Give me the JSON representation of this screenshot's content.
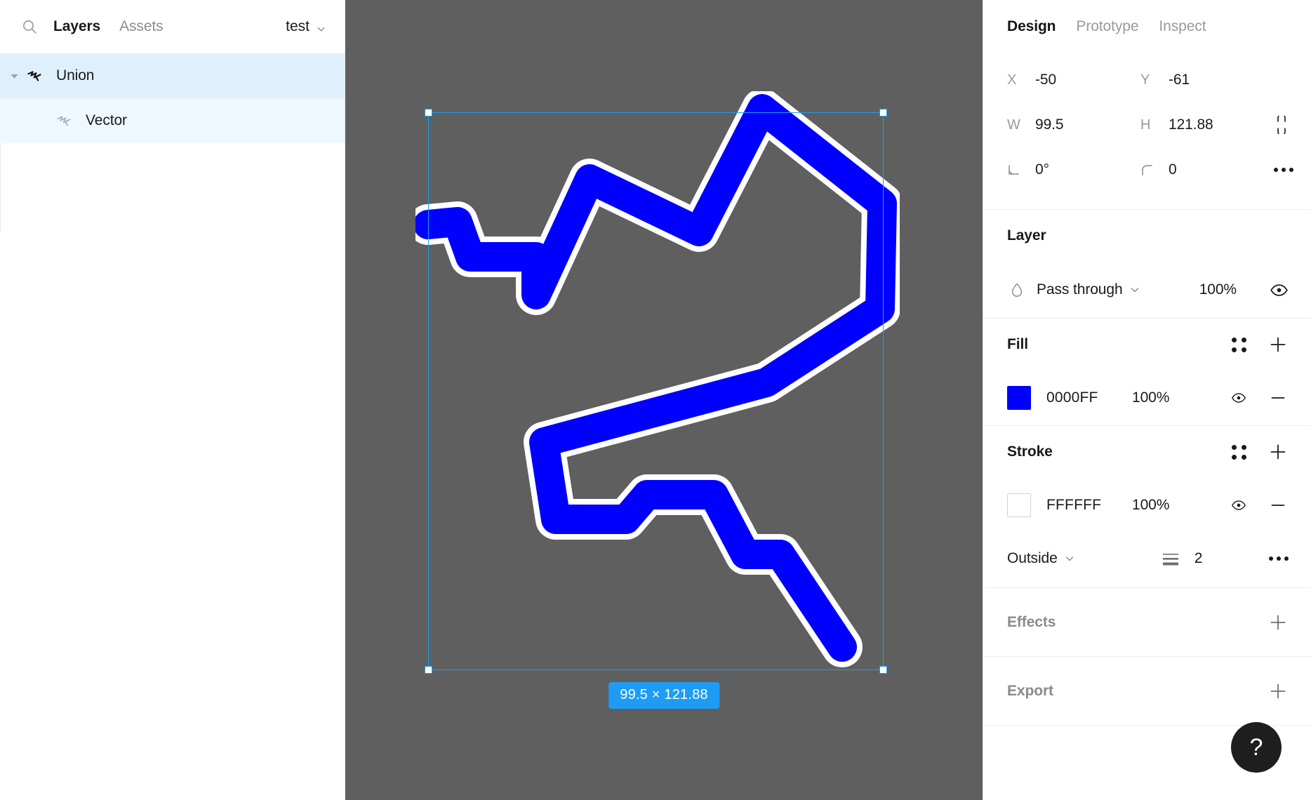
{
  "left_panel": {
    "search_icon": "search-icon",
    "tabs": [
      {
        "label": "Layers",
        "active": true
      },
      {
        "label": "Assets",
        "active": false
      }
    ],
    "page_selector": {
      "label": "test",
      "chevron": "chevron-down-icon"
    },
    "layers": [
      {
        "name": "Union",
        "icon": "vector-path-icon",
        "depth": 0,
        "selected": true,
        "expanded": true
      },
      {
        "name": "Vector",
        "icon": "vector-path-icon",
        "depth": 1,
        "selected": false,
        "expanded": false
      }
    ]
  },
  "canvas": {
    "background_color": "#5f5f5f",
    "selection_color": "#1e9cf5",
    "size_badge": "99.5 × 121.88",
    "shape": {
      "fill_color": "#0000FF",
      "stroke_color": "#FFFFFF",
      "stroke_width": 2,
      "name": "Union"
    }
  },
  "right_panel": {
    "tabs": [
      {
        "label": "Design",
        "active": true
      },
      {
        "label": "Prototype",
        "active": false
      },
      {
        "label": "Inspect",
        "active": false
      }
    ],
    "geometry": {
      "x_label": "X",
      "x_value": "-50",
      "y_label": "Y",
      "y_value": "-61",
      "w_label": "W",
      "w_value": "99.5",
      "h_label": "H",
      "h_value": "121.88",
      "rotation_value": "0°",
      "corner_radius_value": "0",
      "constrain_icon": "constrain-proportions-icon",
      "more_icon": "more-options-icon"
    },
    "layer": {
      "title": "Layer",
      "blend_icon": "blend-mode-icon",
      "blend_mode": "Pass through",
      "blend_chevron": "chevron-down-icon",
      "opacity": "100%",
      "visibility_icon": "eye-icon"
    },
    "fill": {
      "title": "Fill",
      "styles_icon": "styles-grid-icon",
      "add_icon": "plus-icon",
      "swatch_color": "#0000FF",
      "hex": "0000FF",
      "opacity": "100%",
      "visibility_icon": "eye-icon",
      "remove_icon": "minus-icon"
    },
    "stroke": {
      "title": "Stroke",
      "styles_icon": "styles-grid-icon",
      "add_icon": "plus-icon",
      "swatch_color": "#FFFFFF",
      "hex": "FFFFFF",
      "opacity": "100%",
      "visibility_icon": "eye-icon",
      "remove_icon": "minus-icon",
      "align": "Outside",
      "align_chevron": "chevron-down-icon",
      "weight_icon": "stroke-weight-icon",
      "weight": "2",
      "more_icon": "more-options-icon"
    },
    "effects": {
      "title": "Effects",
      "add_icon": "plus-icon"
    },
    "export": {
      "title": "Export",
      "add_icon": "plus-icon"
    },
    "help_button": {
      "label": "?",
      "icon": "help-icon"
    }
  }
}
